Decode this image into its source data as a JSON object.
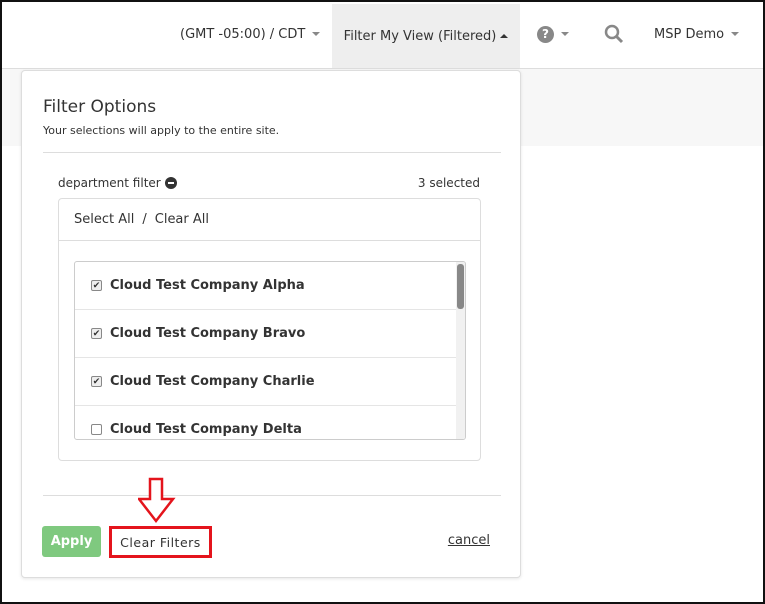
{
  "topbar": {
    "timezone": "(GMT -05:00) / CDT",
    "filter_view": "Filter My View (Filtered)",
    "help_icon": "question-circle-icon",
    "search_icon": "search-icon",
    "user": "MSP Demo"
  },
  "panel": {
    "title": "Filter Options",
    "subtitle": "Your selections will apply to the entire site.",
    "filter_label": "department filter",
    "selected_count": "3 selected",
    "select_all": "Select All",
    "separator": "/",
    "clear_all": "Clear All",
    "items": [
      {
        "label": "Cloud Test Company Alpha",
        "checked": true
      },
      {
        "label": "Cloud Test Company Bravo",
        "checked": true
      },
      {
        "label": "Cloud Test Company Charlie",
        "checked": true
      },
      {
        "label": "Cloud Test Company Delta",
        "checked": false
      }
    ],
    "apply": "Apply",
    "clear_filters": "Clear Filters",
    "cancel": "cancel"
  },
  "annotation": {
    "color": "#e4141c"
  },
  "colors": {
    "apply": "#7fc97f"
  }
}
